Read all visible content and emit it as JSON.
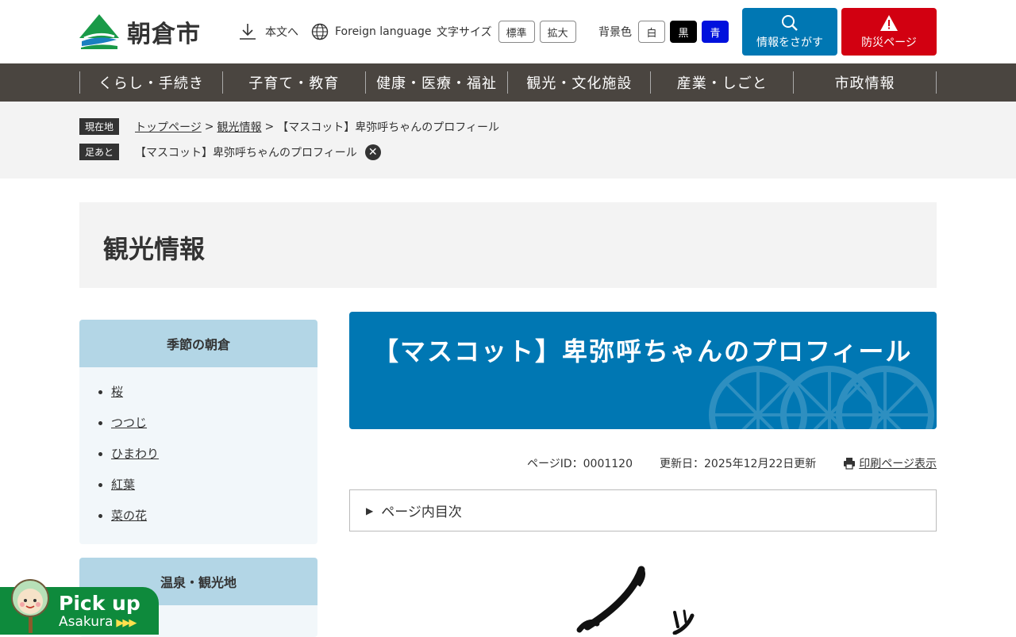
{
  "header": {
    "logo_text": "朝倉市",
    "skip_link": "本文へ",
    "foreign_language": "Foreign language",
    "font_size_label": "文字サイズ",
    "font_size_standard": "標準",
    "font_size_large": "拡大",
    "bg_color_label": "背景色",
    "bg_white": "白",
    "bg_black": "黒",
    "bg_blue": "青",
    "search_button": "情報をさがす",
    "disaster_button": "防災ページ"
  },
  "nav": {
    "items": [
      "くらし・手続き",
      "子育て・教育",
      "健康・医療・福祉",
      "観光・文化施設",
      "産業・しごと",
      "市政情報"
    ]
  },
  "breadcrumb": {
    "current_tag": "現在地",
    "top": "トップページ",
    "sep": ">",
    "section": "観光情報",
    "current": "【マスコット】卑弥呼ちゃんのプロフィール",
    "history_tag": "足あと",
    "history_item": "【マスコット】卑弥呼ちゃんのプロフィール",
    "close_glyph": "✕"
  },
  "category": {
    "title": "観光情報"
  },
  "sidebar": {
    "box1": {
      "heading": "季節の朝倉",
      "items": [
        "桜",
        "つつじ",
        "ひまわり",
        "紅葉",
        "菜の花"
      ]
    },
    "box2": {
      "heading": "温泉・観光地"
    }
  },
  "main": {
    "title": "【マスコット】卑弥呼ちゃんのプロフィール",
    "page_id": "ページID：0001120",
    "updated": "更新日：2025年12月22日更新",
    "print": "印刷ページ表示",
    "toc_triangle": "▶",
    "toc": "ページ内目次"
  },
  "pickup": {
    "line1": "Pick up",
    "line2": "Asakura",
    "arrows": "▶▶▶"
  },
  "colors": {
    "accent_blue": "#0077b3",
    "disaster_red": "#d20011",
    "nav_bg": "#4a4540",
    "pickup_green": "#0e8a3c"
  }
}
